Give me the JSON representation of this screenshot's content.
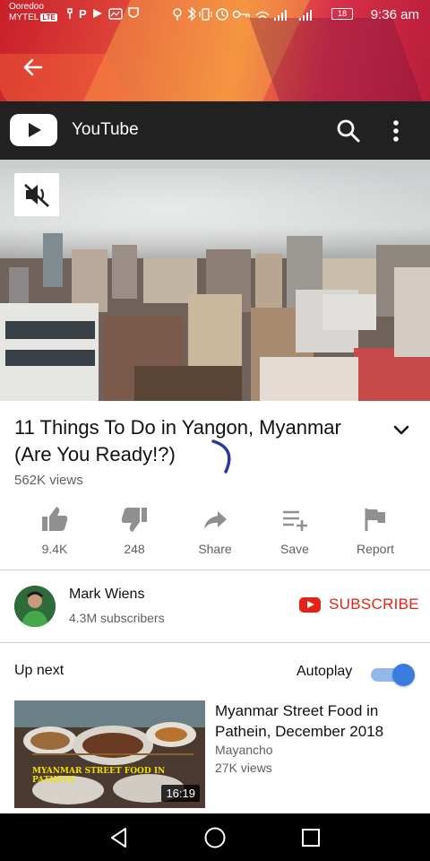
{
  "status_bar": {
    "carrier_1": "Ooredoo",
    "carrier_2": "MYTEL",
    "lte_badge": "LTE",
    "battery": "18",
    "time": "9:36 am"
  },
  "app_bar": {
    "title": "YouTube",
    "icons": {
      "back": "back-arrow-icon",
      "search": "search-icon",
      "more": "more-vert-icon"
    }
  },
  "video": {
    "title": "11 Things To Do in Yangon, Myanmar (Are You Ready!?)",
    "views": "562K views",
    "muted": true
  },
  "actions": [
    {
      "icon": "thumbs-up-icon",
      "label": "9.4K"
    },
    {
      "icon": "thumbs-down-icon",
      "label": "248"
    },
    {
      "icon": "share-icon",
      "label": "Share"
    },
    {
      "icon": "playlist-add-icon",
      "label": "Save"
    },
    {
      "icon": "flag-icon",
      "label": "Report"
    }
  ],
  "channel": {
    "name": "Mark Wiens",
    "subscribers": "4.3M subscribers",
    "subscribe_label": "SUBSCRIBE"
  },
  "up_next": {
    "heading": "Up next",
    "autoplay_label": "Autoplay",
    "autoplay_on": true,
    "item": {
      "title": "Myanmar Street Food in Pathein, December 2018",
      "channel": "Mayancho",
      "views": "27K views",
      "duration": "16:19",
      "thumbnail_caption": "MYANMAR STREET FOOD IN PATHEIN"
    }
  },
  "colors": {
    "accent_red": "#e62117",
    "toggle_blue": "#3a7cde",
    "app_bar_bg": "#212121"
  }
}
